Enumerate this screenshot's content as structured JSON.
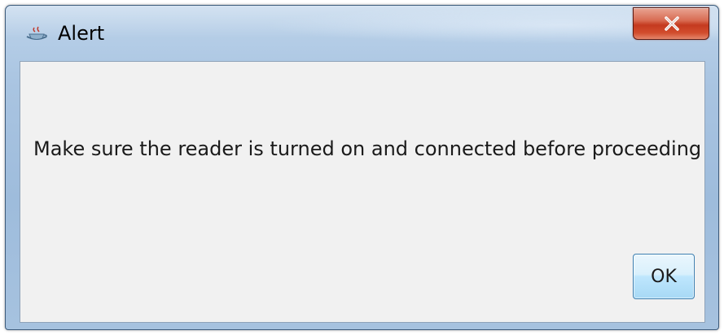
{
  "dialog": {
    "title": "Alert",
    "app_icon": "java-cup-icon",
    "close_icon": "close-icon",
    "message": "Make sure the reader is turned on and connected before proceeding",
    "ok_label": "OK"
  },
  "colors": {
    "frame": "#a9c4e1",
    "client_background": "#f1f1f1",
    "close_button": "#c43a1f",
    "ok_button": "#bee6fd"
  }
}
